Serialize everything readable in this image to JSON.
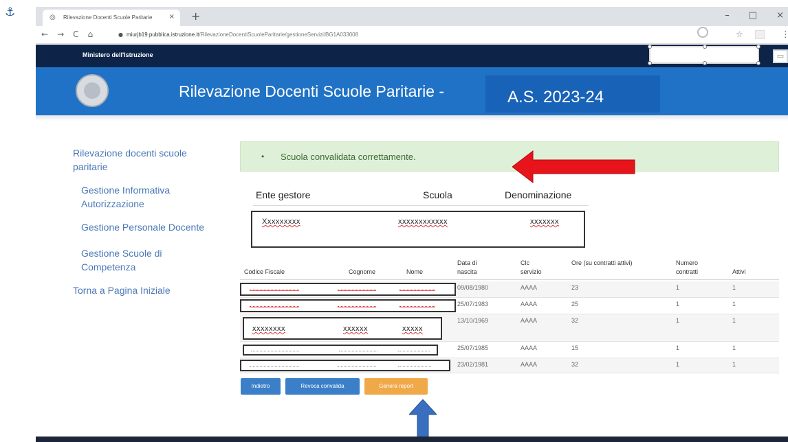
{
  "os": {
    "anchor_icon": "anchor-icon"
  },
  "browser": {
    "tab_title": "Rilevazione Docenti Scuole Paritarie",
    "tab_close": "×",
    "new_tab": "+",
    "window_controls": [
      "–",
      "□",
      "×"
    ],
    "nav": [
      "←",
      "→",
      "C",
      "⌂"
    ],
    "url_host": "miurjb19.pubblica.istruzione.it",
    "url_path": "/RilevazioneDocentiScuoleParitarie/gestioneServizi/BG1A033008",
    "bookmark_icon": "☆",
    "menu_icon": "⋮"
  },
  "site": {
    "ministry": "Ministero dell'Istruzione",
    "title": "Rilevazione Docenti Scuole Paritarie -",
    "school_year": "A.S. 2023-24"
  },
  "sidebar": {
    "items": [
      {
        "label": "Rilevazione docenti scuole paritarie"
      },
      {
        "label": "Gestione Informativa Autorizzazione"
      },
      {
        "label": "Gestione Personale Docente"
      },
      {
        "label": "Gestione Scuole di Competenza"
      },
      {
        "label": "Torna a Pagina Iniziale"
      }
    ]
  },
  "alert": {
    "bullet": "•",
    "message": "Scuola convalidata correttamente."
  },
  "ente": {
    "headers": [
      "Ente gestore",
      "Scuola",
      "Denominazione"
    ],
    "values": [
      "Xxxxxxxxx",
      "xxxxxxxxxxxx",
      "xxxxxxx"
    ]
  },
  "table": {
    "headers": [
      "Codice Fiscale",
      "Cognome",
      "Nome",
      "Data di nascita",
      "Clc servizio",
      "Ore (su contratti attivi)",
      "Numero contratti",
      "Attivi"
    ],
    "rows": [
      {
        "data_nascita": "09/08/1980",
        "clc": "AAAA",
        "ore": "23",
        "numero": "1",
        "attivi": "1"
      },
      {
        "data_nascita": "25/07/1983",
        "clc": "AAAA",
        "ore": "25",
        "numero": "1",
        "attivi": "1"
      },
      {
        "codice": "xxxxxxxx",
        "cognome": "xxxxxx",
        "nome": "xxxxx",
        "data_nascita": "13/10/1969",
        "clc": "AAAA",
        "ore": "32",
        "numero": "1",
        "attivi": "1"
      },
      {
        "data_nascita": "25/07/1985",
        "clc": "AAAA",
        "ore": "15",
        "numero": "1",
        "attivi": "1"
      },
      {
        "data_nascita": "23/02/1981",
        "clc": "AAAA",
        "ore": "32",
        "numero": "1",
        "attivi": "1"
      }
    ]
  },
  "buttons": {
    "back": "Indietro",
    "revoke": "Revoca convalida",
    "report": "Genera report"
  },
  "colors": {
    "header_dark": "#0d2448",
    "banner_blue": "#1f72c5",
    "alert_green": "#dff0d8",
    "button_blue": "#3b7fc8",
    "button_orange": "#f0a949",
    "annotation_red": "#e8141c",
    "annotation_blue": "#3a6fbf"
  }
}
